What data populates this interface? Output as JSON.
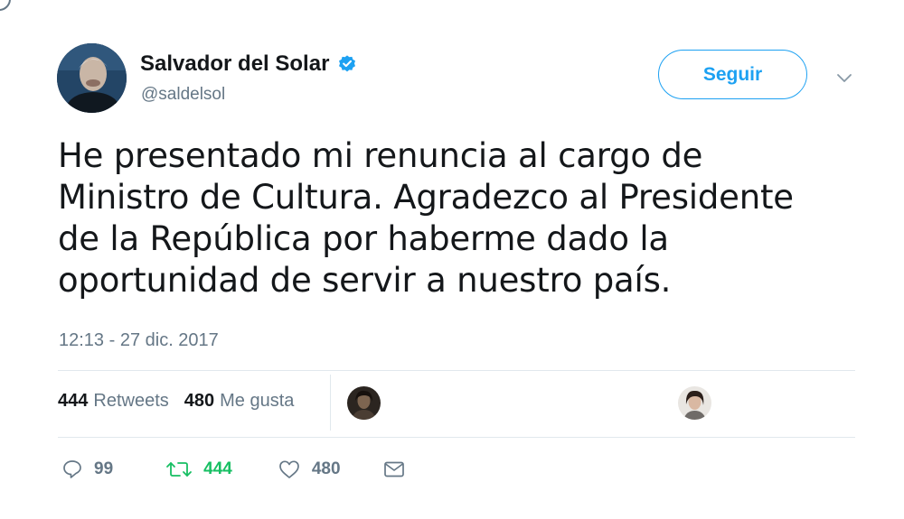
{
  "user": {
    "display_name": "Salvador del Solar",
    "handle": "@saldelsol",
    "verified": true
  },
  "follow_button": {
    "label": "Seguir"
  },
  "tweet": {
    "lines": [
      "He presentado mi renuncia al cargo de",
      "Ministro de Cultura. Agradezco al Presidente",
      "de la República por haberme dado la",
      "oportunidad de servir a nuestro país."
    ],
    "timestamp": "12:13 - 27 dic. 2017"
  },
  "stats": {
    "retweets_count": "444",
    "retweets_label": "Retweets",
    "likes_count": "480",
    "likes_label": "Me gusta"
  },
  "actions": {
    "replies": "99",
    "retweets": "444",
    "likes": "480"
  },
  "colors": {
    "brand": "#1da1f2",
    "retweet_green": "#17bf63",
    "secondary_text": "#657786"
  },
  "icons": [
    "verified-badge-icon",
    "chevron-down-icon",
    "reply-icon",
    "retweet-icon",
    "heart-icon",
    "direct-message-icon"
  ]
}
